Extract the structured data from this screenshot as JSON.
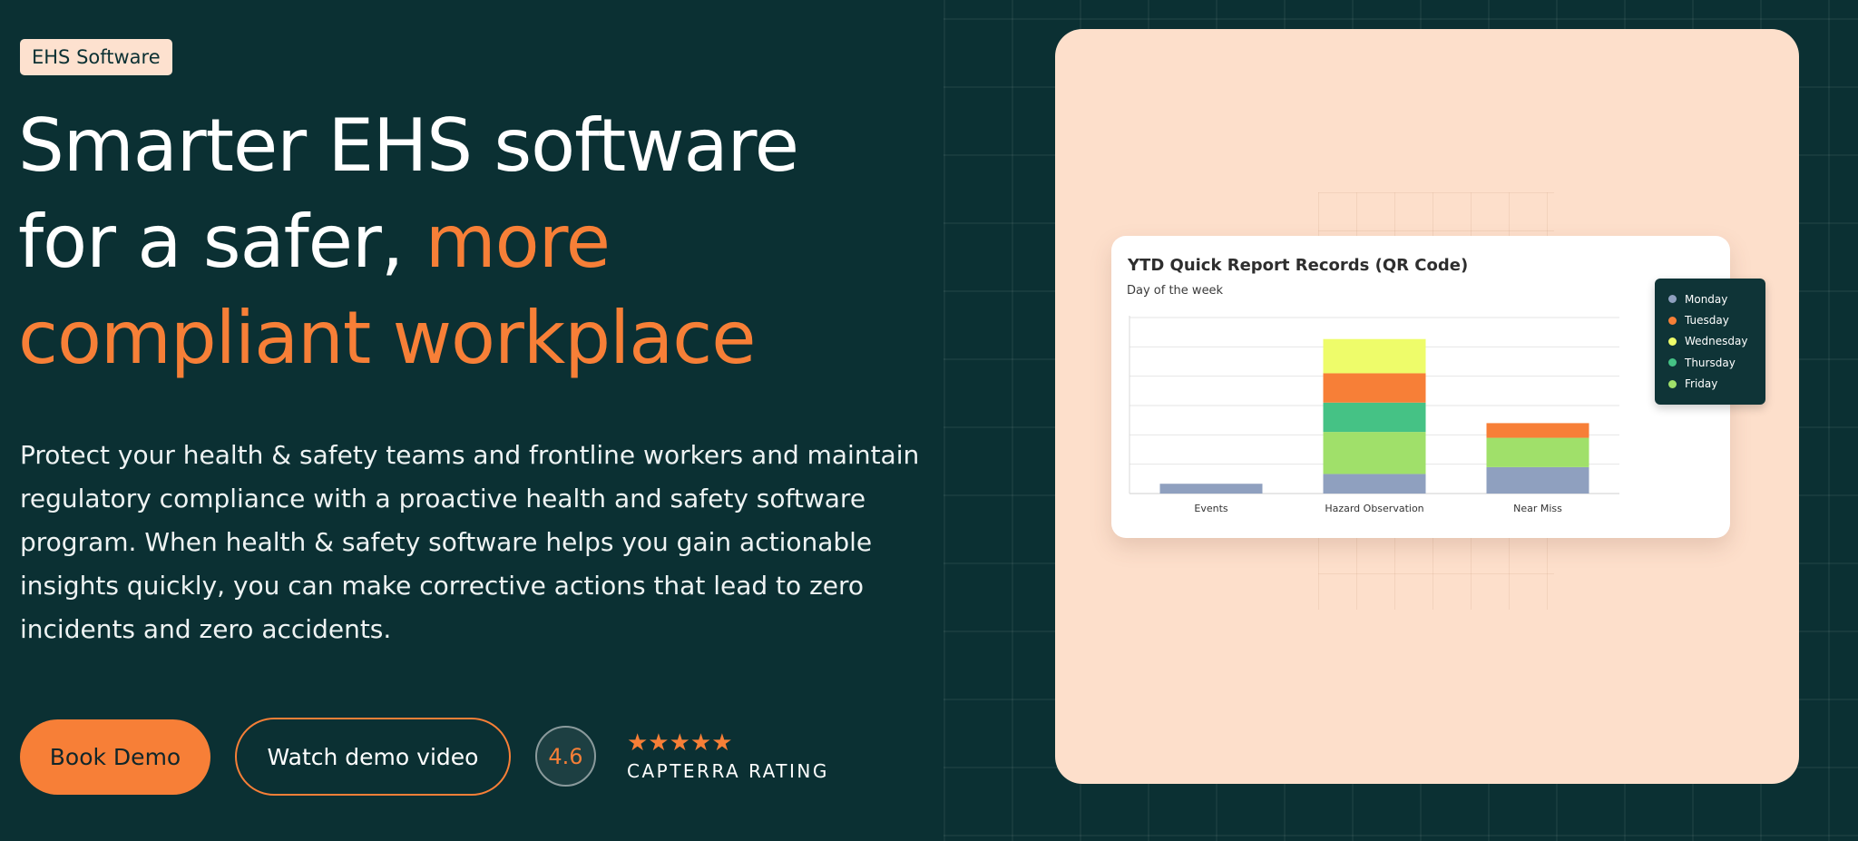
{
  "badge": {
    "label": "EHS Software"
  },
  "hero": {
    "headline_line1": "Smarter EHS software",
    "headline_line2_plain": "for a safer, ",
    "headline_line2_accent": "more",
    "headline_line3_accent": "compliant workplace",
    "description": "Protect your health & safety teams and frontline workers and maintain regulatory compliance with a proactive health and safety software program. When health & safety software helps you gain actionable insights quickly, you can make corrective actions that lead to zero incidents and zero accidents."
  },
  "actions": {
    "book_demo_label": "Book Demo",
    "watch_video_label": "Watch demo video"
  },
  "rating": {
    "score": "4.6",
    "stars": "★★★★★",
    "stars_count": 5,
    "label": "CAPTERRA RATING"
  },
  "colors": {
    "background": "#0b3033",
    "accent": "#f77f37",
    "panel": "#fddfcb"
  },
  "chart_data": {
    "type": "bar",
    "stacked": true,
    "title": "YTD Quick Report Records (QR Code)",
    "subtitle": "Day of the week",
    "categories": [
      "Events",
      "Hazard Observation",
      "Near Miss"
    ],
    "series": [
      {
        "name": "Monday",
        "color": "#8fa0bf",
        "values": [
          1,
          2,
          2.7
        ]
      },
      {
        "name": "Friday",
        "color": "#a0e06a",
        "values": [
          0,
          4.3,
          3
        ]
      },
      {
        "name": "Thursday",
        "color": "#45c285",
        "values": [
          0,
          3,
          0
        ]
      },
      {
        "name": "Tuesday",
        "color": "#f77f37",
        "values": [
          0,
          3,
          1.5
        ]
      },
      {
        "name": "Wednesday",
        "color": "#eefc6a",
        "values": [
          0,
          3.5,
          0
        ]
      }
    ],
    "ylim": [
      0,
      18
    ],
    "grid": true,
    "legend_order": [
      "Monday",
      "Tuesday",
      "Wednesday",
      "Thursday",
      "Friday"
    ],
    "legend_placement": "right"
  }
}
